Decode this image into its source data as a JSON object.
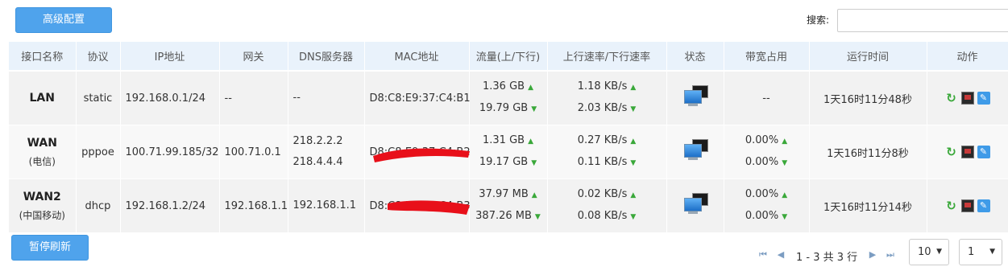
{
  "toolbar": {
    "advanced_label": "高级配置",
    "search_label": "搜索:",
    "search_value": "",
    "pause_label": "暂停刷新"
  },
  "table": {
    "headers": [
      "接口名称",
      "协议",
      "IP地址",
      "网关",
      "DNS服务器",
      "MAC地址",
      "流量(上/下行)",
      "上行速率/下行速率",
      "状态",
      "带宽占用",
      "运行时间",
      "动作"
    ],
    "rows": [
      {
        "name": "LAN",
        "name_sub": "",
        "protocol": "static",
        "ip": "192.168.0.1/24",
        "gateway": "--",
        "dns1": "--",
        "dns2": "",
        "mac": "D8:C8:E9:37:C4:B1",
        "mac_redacted": false,
        "traffic_up": "1.36 GB",
        "traffic_down": "19.79 GB",
        "rate_up": "1.18 KB/s",
        "rate_down": "2.03 KB/s",
        "bw_up": "--",
        "bw_down": "",
        "uptime": "1天16时11分48秒"
      },
      {
        "name": "WAN",
        "name_sub": "(电信)",
        "protocol": "pppoe",
        "ip": "100.71.99.185/32",
        "gateway": "100.71.0.1",
        "dns1": "218.2.2.2",
        "dns2": "218.4.4.4",
        "mac": "D8:C8:E9:37:C4:B2",
        "mac_redacted": true,
        "traffic_up": "1.31 GB",
        "traffic_down": "19.17 GB",
        "rate_up": "0.27 KB/s",
        "rate_down": "0.11 KB/s",
        "bw_up": "0.00%",
        "bw_down": "0.00%",
        "uptime": "1天16时11分8秒"
      },
      {
        "name": "WAN2",
        "name_sub": "(中国移动)",
        "protocol": "dhcp",
        "ip": "192.168.1.2/24",
        "gateway": "192.168.1.1",
        "dns1": "192.168.1.1",
        "dns2": "",
        "mac": "D8:C8:E9:37:C4:B3",
        "mac_redacted": true,
        "traffic_up": "37.97 MB",
        "traffic_down": "387.26 MB",
        "rate_up": "0.02 KB/s",
        "rate_down": "0.08 KB/s",
        "bw_up": "0.00%",
        "bw_down": "0.00%",
        "uptime": "1天16时11分14秒"
      }
    ]
  },
  "pager": {
    "info": "1 - 3 共 3 行",
    "page_size": "10",
    "page": "1"
  },
  "colors": {
    "accent": "#4fa3ec",
    "header_bg": "#e9f2fb",
    "arrow": "#3aa83a",
    "redact": "#e8101a"
  },
  "icons": {
    "status": "monitor-icon",
    "actions": [
      "refresh-icon",
      "screen-icon",
      "edit-icon"
    ],
    "pager": [
      "first-page-icon",
      "prev-page-icon",
      "next-page-icon",
      "last-page-icon"
    ]
  }
}
